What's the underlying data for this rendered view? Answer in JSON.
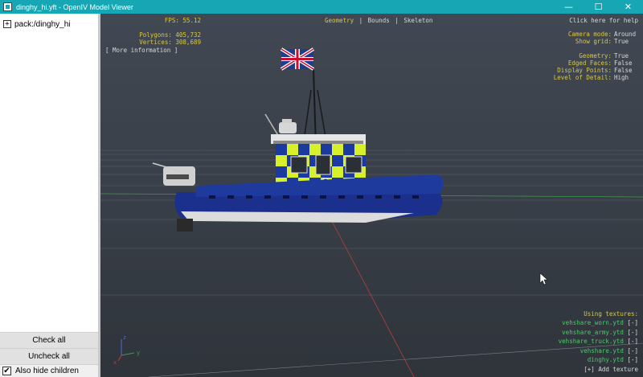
{
  "window": {
    "title": "dinghy_hi.yft - OpenIV Model Viewer",
    "controls": {
      "minimize": "—",
      "maximize": "☐",
      "close": "✕"
    }
  },
  "sidebar": {
    "tree": [
      {
        "expander": "+",
        "label": "pack:/dinghy_hi"
      }
    ],
    "check_all_label": "Check all",
    "uncheck_all_label": "Uncheck all",
    "also_hide_children": {
      "label": "Also hide children",
      "checked": true,
      "mark": "✔"
    }
  },
  "viewport": {
    "stats": {
      "fps": "FPS: 55.12",
      "polygons": "Polygons: 405,732",
      "vertices": "Vertices: 308,689"
    },
    "more_info": "[ More information ]",
    "mode_tabs": [
      {
        "label": "Geometry",
        "active": true
      },
      {
        "label": "|",
        "active": false
      },
      {
        "label": "Bounds",
        "active": false
      },
      {
        "label": "|",
        "active": false
      },
      {
        "label": "Skeleton",
        "active": false
      }
    ],
    "help": "Click here for help",
    "settings": [
      {
        "key": "Camera mode:",
        "value": "Around"
      },
      {
        "key": "Show grid:",
        "value": "True"
      },
      {
        "key": "",
        "value": ""
      },
      {
        "key": "Geometry:",
        "value": "True"
      },
      {
        "key": "Edged Faces:",
        "value": "False"
      },
      {
        "key": "Display Points:",
        "value": "False"
      },
      {
        "key": "Level of Detail:",
        "value": "High"
      }
    ],
    "textures": {
      "heading": "Using textures:",
      "items": [
        {
          "name": "vehshare_worn.ytd",
          "action": "[-]"
        },
        {
          "name": "vehshare_army.ytd",
          "action": "[-]"
        },
        {
          "name": "vehshare_truck.ytd",
          "action": "[-]"
        },
        {
          "name": "vehshare.ytd",
          "action": "[-]"
        },
        {
          "name": "dinghy.ytd",
          "action": "[-]"
        }
      ],
      "add_label": "[+] Add texture"
    },
    "axes": {
      "x": "x",
      "y": "y",
      "z": "z"
    },
    "colors": {
      "label_yellow": "#d9c74a",
      "value_white": "#d8d8d8",
      "texture_green": "#4ec86a",
      "titlebar": "#17a6b4",
      "hull_blue": "#1b2f8c",
      "battenburg_yellow": "#d8f02a"
    }
  }
}
